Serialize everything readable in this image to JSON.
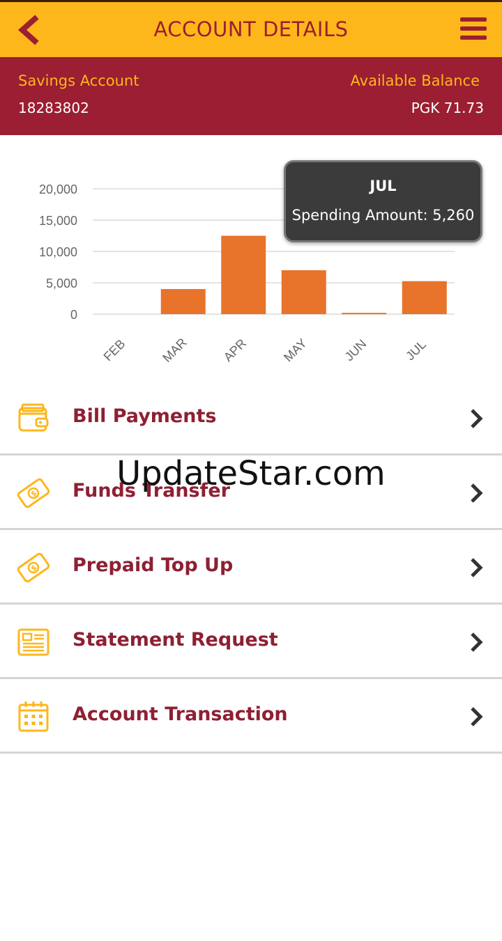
{
  "header": {
    "title": "ACCOUNT DETAILS",
    "back_icon": "chevron-left-icon",
    "menu_icon": "hamburger-icon",
    "bg_color": "#fdb71a",
    "title_color": "#9b1e32"
  },
  "account": {
    "type_label": "Savings Account",
    "number": "18283802",
    "balance_label": "Available Balance",
    "balance_value": "PGK 71.73",
    "bg_color": "#9b1e32",
    "label_color": "#fdb71a"
  },
  "chart_data": {
    "type": "bar",
    "categories": [
      "FEB",
      "MAR",
      "APR",
      "MAY",
      "JUN",
      "JUL"
    ],
    "values": [
      0,
      4000,
      12500,
      7000,
      200,
      5260
    ],
    "yticks": [
      "0",
      "5,000",
      "10,000",
      "15,000",
      "20,000"
    ],
    "ylim": [
      0,
      20000
    ],
    "grid": true,
    "bar_color": "#e8732a",
    "tooltip": {
      "title": "JUL",
      "label": "Spending Amount:",
      "value": "5,260"
    }
  },
  "menu": {
    "items": [
      {
        "label": "Bill Payments",
        "icon": "wallet-icon"
      },
      {
        "label": "Funds Transfer",
        "icon": "money-bill-icon"
      },
      {
        "label": "Prepaid Top Up",
        "icon": "money-bill-icon"
      },
      {
        "label": "Statement Request",
        "icon": "document-icon"
      },
      {
        "label": "Account Transaction",
        "icon": "calendar-icon"
      }
    ],
    "label_color": "#8e2033",
    "icon_color": "#fdb71a"
  },
  "watermark": "UpdateStar.com"
}
